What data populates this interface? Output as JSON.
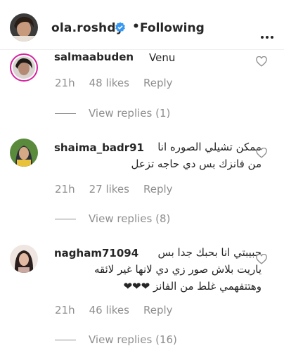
{
  "header": {
    "username": "ola.roshdy",
    "separator": "•",
    "follow_label": "Following"
  },
  "comments": [
    {
      "username": "salmaabuden",
      "text": "",
      "partial_text": "Venu",
      "time": "21h",
      "likes": "48 likes",
      "reply": "Reply",
      "view_replies": "View replies (1)"
    },
    {
      "username": "shaima_badr91",
      "line1": "ممكن تشيلي الصوره انا",
      "line2": "من فانزك بس دي حاجه تزعل",
      "time": "21h",
      "likes": "27 likes",
      "reply": "Reply",
      "view_replies": "View replies (8)"
    },
    {
      "username": "nagham71094",
      "line1": "حبيبتي انا بحبك جدا بس",
      "line2": "ياريت بلاش صور زي دي لانها غير لائقه",
      "line3": "وهتتفهمي غلط من الفانز ❤❤❤",
      "time": "21h",
      "likes": "46 likes",
      "reply": "Reply",
      "view_replies": "View replies (16)"
    }
  ],
  "colors": {
    "text": "#262626",
    "muted": "#8e8e8e",
    "verified": "#3897f0"
  }
}
